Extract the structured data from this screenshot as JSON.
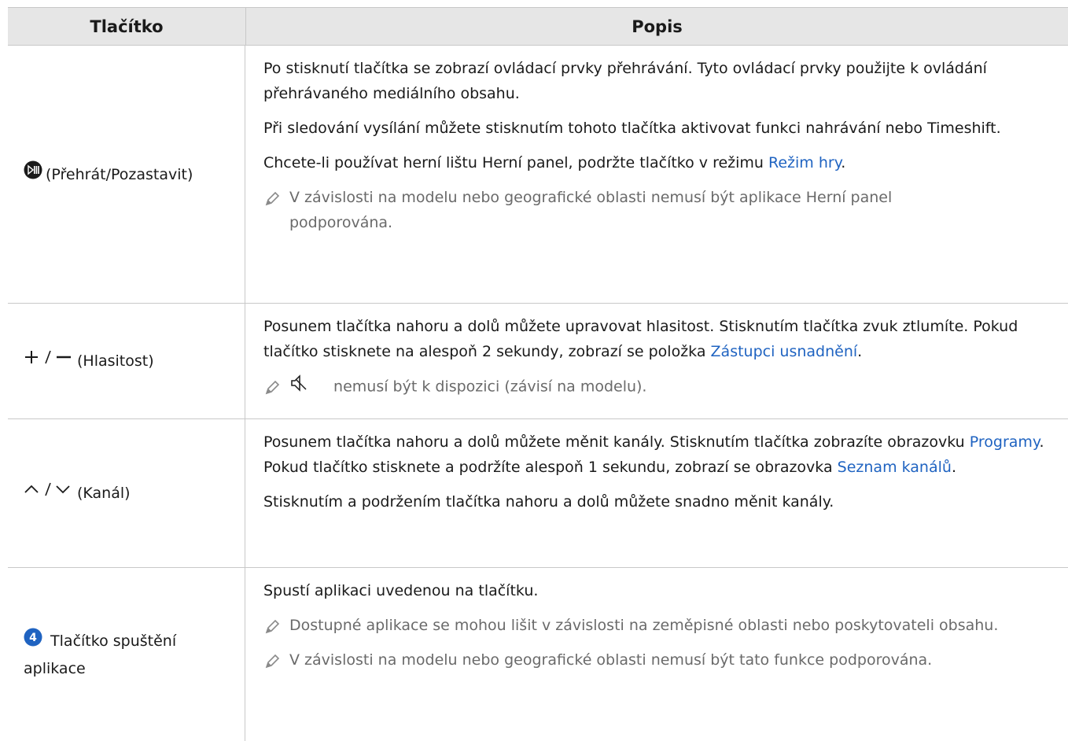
{
  "header": {
    "col1": "Tlačítko",
    "col2": "Popis"
  },
  "rows": [
    {
      "button": "(Přehrát/Pozastavit)",
      "icon": "play-pause-icon",
      "p1": "Po stisknutí tlačítka se zobrazí ovládací prvky přehrávání. Tyto ovládací prvky použijte k ovládání přehrávaného mediálního obsahu.",
      "p2": "Při sledování vysílání můžete stisknutím tohoto tlačítka aktivovat funkci nahrávání nebo Timeshift.",
      "p3_a": "Chcete-li používat herní lištu Herní panel, podržte tlačítko v režimu ",
      "p3_link": "Režim hry",
      "p3_b": ".",
      "note1": "V závislosti na modelu nebo geografické oblasti nemusí být aplikace Herní panel podporována."
    },
    {
      "button": "(Hlasitost)",
      "icon": "volume-plus-minus-icon",
      "p1_a": "Posunem tlačítka nahoru a dolů můžete upravovat hlasitost. Stisknutím tlačítka zvuk ztlumíte. Pokud tlačítko stisknete na alespoň 2 sekundy, zobrazí se položka ",
      "p1_link": "Zástupci usnadnění",
      "p1_b": ".",
      "note1": "nemusí být k dispozici (závisí na modelu).",
      "note_icon": "mute-icon"
    },
    {
      "button": "(Kanál)",
      "icon": "channel-up-down-icon",
      "p1_a": "Posunem tlačítka nahoru a dolů můžete měnit kanály. Stisknutím tlačítka zobrazíte obrazovku ",
      "p1_link1": "Programy",
      "p1_b": ". Pokud tlačítko stisknete a podržíte alespoň 1 sekundu, zobrazí se obrazovka ",
      "p1_link2": "Seznam kanálů",
      "p1_c": ".",
      "p2": "Stisknutím a podržením tlačítka nahoru a dolů můžete snadno měnit kanály."
    },
    {
      "button_a": "Tlačítko spuštění",
      "button_b": "aplikace",
      "badge": "4",
      "p1": "Spustí aplikaci uvedenou na tlačítku.",
      "note1": "Dostupné aplikace se mohou lišit v závislosti na zeměpisné oblasti nebo poskytovateli obsahu.",
      "note2": "V závislosti na modelu nebo geografické oblasti nemusí být tato funkce podporována."
    }
  ],
  "colors": {
    "link": "#1f63c1",
    "note": "#6a6a6a",
    "header_bg": "#e6e6e6"
  }
}
